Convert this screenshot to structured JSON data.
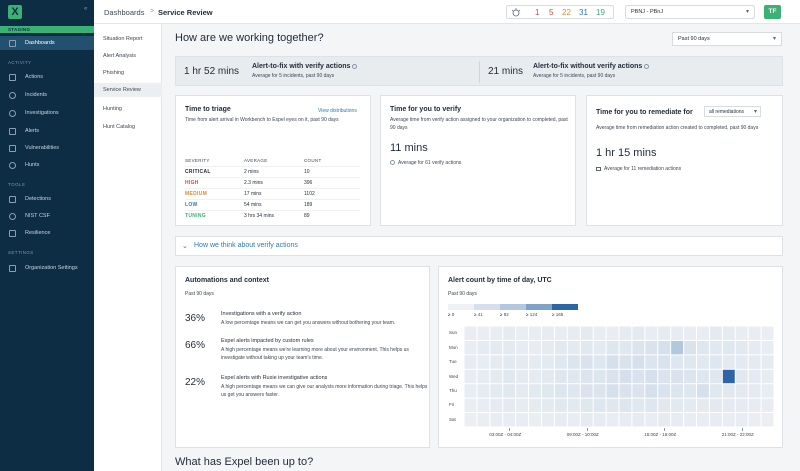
{
  "nav": {
    "staging_label": "STAGING",
    "items_top": [
      {
        "label": "Dashboards",
        "icon": "dashboard-icon",
        "active": true
      }
    ],
    "activity_label": "ACTIVITY",
    "activity_items": [
      {
        "label": "Actions",
        "icon": "actions-icon"
      },
      {
        "label": "Incidents",
        "icon": "incidents-icon"
      },
      {
        "label": "Investigations",
        "icon": "investigations-icon"
      },
      {
        "label": "Alerts",
        "icon": "alerts-icon"
      },
      {
        "label": "Vulnerabilities",
        "icon": "vulnerabilities-icon"
      },
      {
        "label": "Hunts",
        "icon": "hunts-icon"
      }
    ],
    "tools_label": "TOOLS",
    "tools_items": [
      {
        "label": "Detections",
        "icon": "detections-icon"
      },
      {
        "label": "NIST CSF",
        "icon": "nist-icon"
      },
      {
        "label": "Resilience",
        "icon": "resilience-icon"
      }
    ],
    "settings_label": "SETTINGS",
    "settings_items": [
      {
        "label": "Organization Settings",
        "icon": "org-settings-icon"
      }
    ]
  },
  "subnav": {
    "items": [
      "Situation Report",
      "Alert Analysis",
      "Phishing",
      "Service Review",
      "Hunting",
      "Hunt Catalog"
    ],
    "active_index": 3
  },
  "topbar": {
    "breadcrumb_root": "Dashboards",
    "breadcrumb_sep": ">",
    "breadcrumb_current": "Service Review",
    "counts": [
      {
        "value": "1",
        "color": "#d64545"
      },
      {
        "value": "5",
        "color": "#d64545"
      },
      {
        "value": "22",
        "color": "#e08a2b"
      },
      {
        "value": "31",
        "color": "#2b7bb9"
      },
      {
        "value": "19",
        "color": "#3bb274"
      }
    ],
    "org_select": "PBNJ - PBnJ",
    "avatar": "TF"
  },
  "main": {
    "heading": "How are we working together?",
    "range": "Past 90 days",
    "band": {
      "left_value": "1 hr 52 mins",
      "left_title": "Alert-to-fix with verify actions",
      "left_sub": "Average for 5 incidents, past 90 days",
      "right_value": "21 mins",
      "right_title": "Alert-to-fix without verify actions",
      "right_sub": "Average for 5 incidents, past 90 days"
    },
    "triage": {
      "title": "Time to triage",
      "link": "View distributions",
      "desc": "Time from alert arrival in Workbench to Expel eyes on it, past 90 days",
      "headers": [
        "SEVERITY",
        "AVERAGE",
        "COUNT"
      ],
      "rows": [
        {
          "severity": "CRITICAL",
          "color": "#1f2a37",
          "average": "2 mins",
          "count": "10"
        },
        {
          "severity": "HIGH",
          "color": "#d64545",
          "average": "2.3 mins",
          "count": "396"
        },
        {
          "severity": "MEDIUM",
          "color": "#e08a2b",
          "average": "17 mins",
          "count": "1102"
        },
        {
          "severity": "LOW",
          "color": "#2b7bb9",
          "average": "54 mins",
          "count": "189"
        },
        {
          "severity": "TUNING",
          "color": "#3bb274",
          "average": "3 hrs 34 mins",
          "count": "89"
        }
      ]
    },
    "verify": {
      "title": "Time for you to verify",
      "desc": "Average time from verify action assigned to your organization to completed, past 90 days",
      "value": "11 mins",
      "foot": "Average for 61 verify actions"
    },
    "remediate": {
      "title": "Time for you to remediate for",
      "select": "all remediations",
      "desc": "Average time from remediation action created to completed, past 90 days",
      "value": "1 hr 15 mins",
      "foot": "Average for 11 remediation actions"
    },
    "accordion": "How we think about verify actions",
    "automations": {
      "title": "Automations and context",
      "sub": "Past 90 days",
      "items": [
        {
          "pct": "36%",
          "title": "Investigations with a verify action",
          "desc": "A low percentage means we can get you answers without bothering your team."
        },
        {
          "pct": "66%",
          "title": "Expel alerts impacted by custom rules",
          "desc": "A high percentage means we're learning more about your environment. This helps us investigate without taking up your team's time."
        },
        {
          "pct": "22%",
          "title": "Expel alerts with Ruxie investigative actions",
          "desc": "A high percentage means we can give our analysts more information during triage. This helps us get you answers faster."
        }
      ]
    },
    "next_heading": "What has Expel been up to?"
  },
  "chart_data": {
    "type": "heatmap",
    "title": "Alert count by time of day, UTC",
    "subtitle": "Past 90 days",
    "legend": {
      "bins": [
        "≥ 0",
        "≥ 41",
        "≥ 82",
        "≥ 124",
        "≥ 165"
      ],
      "colors": [
        "#eef1f5",
        "#d6e0ec",
        "#b3c7de",
        "#7fa2c9",
        "#2d65a8"
      ]
    },
    "y_categories": [
      "Sun",
      "Mon",
      "Tue",
      "Wed",
      "Thu",
      "Fri",
      "Sat"
    ],
    "x_tick_labels": [
      "03:00Z - 04:00Z",
      "09:00Z - 10:00Z",
      "15:00Z - 16:00Z",
      "21:00Z - 22:00Z"
    ],
    "x_tick_hours": [
      3,
      9,
      15,
      21
    ],
    "hours": 24,
    "values": [
      [
        10,
        8,
        12,
        15,
        9,
        11,
        14,
        10,
        13,
        18,
        12,
        10,
        15,
        20,
        12,
        16,
        14,
        10,
        12,
        18,
        15,
        12,
        10,
        8
      ],
      [
        12,
        15,
        18,
        20,
        14,
        10,
        16,
        22,
        18,
        25,
        20,
        30,
        28,
        35,
        40,
        45,
        110,
        38,
        30,
        25,
        28,
        22,
        15,
        12
      ],
      [
        14,
        12,
        16,
        22,
        18,
        15,
        20,
        28,
        35,
        40,
        30,
        45,
        38,
        42,
        35,
        40,
        30,
        28,
        25,
        30,
        22,
        20,
        18,
        15
      ],
      [
        10,
        14,
        18,
        24,
        20,
        16,
        22,
        30,
        28,
        35,
        32,
        40,
        45,
        38,
        42,
        36,
        40,
        35,
        30,
        28,
        180,
        25,
        20,
        14
      ],
      [
        12,
        16,
        20,
        25,
        18,
        22,
        28,
        32,
        30,
        38,
        35,
        42,
        40,
        36,
        45,
        38,
        35,
        30,
        55,
        28,
        25,
        22,
        18,
        12
      ],
      [
        8,
        12,
        15,
        18,
        14,
        16,
        20,
        25,
        22,
        28,
        30,
        26,
        32,
        28,
        30,
        25,
        22,
        20,
        18,
        22,
        20,
        16,
        14,
        10
      ],
      [
        6,
        8,
        10,
        12,
        10,
        9,
        12,
        14,
        12,
        15,
        13,
        12,
        14,
        16,
        12,
        15,
        13,
        12,
        10,
        14,
        12,
        10,
        8,
        6
      ]
    ]
  }
}
